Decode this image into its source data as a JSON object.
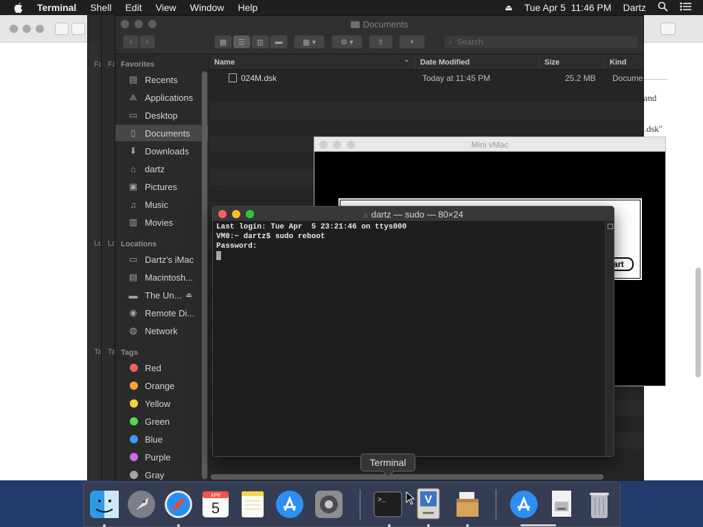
{
  "menubar": {
    "app_name": "Terminal",
    "items": [
      "Shell",
      "Edit",
      "View",
      "Window",
      "Help"
    ],
    "datetime": "Tue Apr 5  11:46 PM",
    "user": "Dartz"
  },
  "background_window": {
    "text_fragments": [
      "r and",
      "1.dsk\""
    ]
  },
  "stacked_windows": {
    "labels": [
      "Fa",
      "Fa",
      "Lo",
      "Lo",
      "Ta",
      "Ta"
    ]
  },
  "finder": {
    "title": "Documents",
    "search_placeholder": "Search",
    "sidebar": {
      "favorites_label": "Favorites",
      "favorites": [
        {
          "label": "Recents",
          "icon": "recents-icon"
        },
        {
          "label": "Applications",
          "icon": "applications-icon"
        },
        {
          "label": "Desktop",
          "icon": "desktop-icon"
        },
        {
          "label": "Documents",
          "icon": "documents-icon"
        },
        {
          "label": "Downloads",
          "icon": "downloads-icon"
        },
        {
          "label": "dartz",
          "icon": "home-icon"
        },
        {
          "label": "Pictures",
          "icon": "pictures-icon"
        },
        {
          "label": "Music",
          "icon": "music-icon"
        },
        {
          "label": "Movies",
          "icon": "movies-icon"
        }
      ],
      "locations_label": "Locations",
      "locations": [
        {
          "label": "Dartz's iMac",
          "icon": "computer-icon"
        },
        {
          "label": "Macintosh...",
          "icon": "hard-disk-icon"
        },
        {
          "label": "The Un...",
          "icon": "external-disk-icon"
        },
        {
          "label": "Remote Di...",
          "icon": "remote-disc-icon"
        },
        {
          "label": "Network",
          "icon": "network-icon"
        }
      ],
      "tags_label": "Tags",
      "tags": [
        {
          "label": "Red",
          "color": "#f05f5f"
        },
        {
          "label": "Orange",
          "color": "#f5a43a"
        },
        {
          "label": "Yellow",
          "color": "#f4d33a"
        },
        {
          "label": "Green",
          "color": "#5bd35a"
        },
        {
          "label": "Blue",
          "color": "#3b9cf2"
        },
        {
          "label": "Purple",
          "color": "#c86fe3"
        },
        {
          "label": "Gray",
          "color": "#a2a2a2"
        }
      ]
    },
    "columns": {
      "name": "Name",
      "date_modified": "Date Modified",
      "size": "Size",
      "kind": "Kind"
    },
    "files": [
      {
        "name": "024M.dsk",
        "date_modified": "Today at 11:45 PM",
        "size": "25.2 MB",
        "kind": "Docume"
      }
    ]
  },
  "minivmac": {
    "title": "Mini vMac",
    "button_label": "art"
  },
  "terminal": {
    "title": "dartz — sudo — 80×24",
    "lines": [
      "Last login: Tue Apr  5 23:21:46 on ttys000",
      "VM0:~ dartz$ sudo reboot",
      "Password:"
    ]
  },
  "tooltip": "Terminal",
  "dock": {
    "apps": [
      "Finder",
      "Launchpad",
      "Safari",
      "Calendar",
      "Notes",
      "App Store",
      "System Preferences",
      "Terminal",
      "Mini vMac",
      "Archive Utility",
      "App Store Downloads",
      "Mini vMac Disk",
      "Trash"
    ],
    "calendar_month": "APR",
    "calendar_day": "5"
  }
}
